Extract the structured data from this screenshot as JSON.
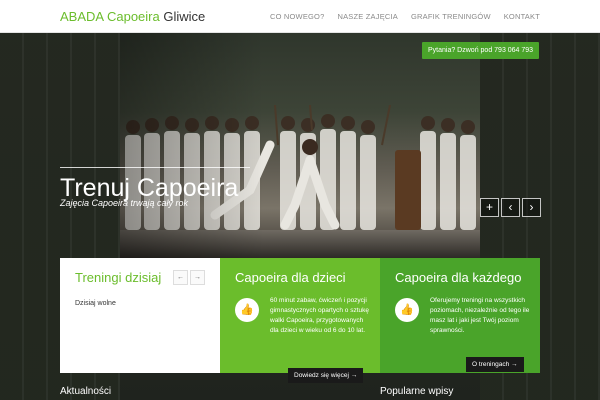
{
  "header": {
    "logo_first": "ABADA Capoeira",
    "logo_second": "Gliwice",
    "nav": [
      "CO NOWEGO?",
      "NASZE ZAJĘCIA",
      "GRAFIK TRENINGÓW",
      "KONTAKT"
    ]
  },
  "hero": {
    "contact": "Pytania? Dzwoń pod 793 064 793",
    "title": "Trenuj Capoeira",
    "subtitle": "Zajęcia Capoeira trwają cały rok",
    "controls": {
      "expand": "+",
      "prev": "‹",
      "next": "›"
    }
  },
  "panels": {
    "training": {
      "title": "Treningi dzisiaj",
      "prev": "←",
      "next": "→",
      "status": "Dzisiaj wolne"
    },
    "kids": {
      "title": "Capoeira dla dzieci",
      "icon": "thumbs-up-icon",
      "text": "60 minut zabaw, ćwiczeń i pozycji gimnastycznych opartych o sztukę walki Capoeira, przygotowanych dla dzieci w wieku od 6 do 10 lat.",
      "button": "Dowiedz się więcej →"
    },
    "everyone": {
      "title": "Capoeira dla każdego",
      "icon": "thumbs-up-icon",
      "text": "Oferujemy treningi na wszystkich poziomach, niezależnie od tego ile masz lat i jaki jest Twój poziom sprawności.",
      "button": "O treningach →"
    }
  },
  "footer_sections": {
    "news": "Aktualności",
    "popular": "Popularne wpisy"
  },
  "colors": {
    "accent": "#6bbd2c",
    "accent_dark": "#4aa42a",
    "button_dark": "#1a1a1a"
  }
}
